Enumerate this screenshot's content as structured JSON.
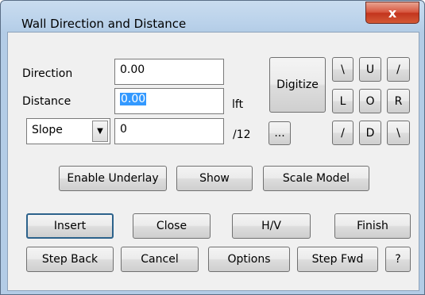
{
  "window": {
    "title": "Wall Direction and Distance",
    "close_glyph": "x"
  },
  "fields": {
    "direction_label": "Direction",
    "direction_value": "0.00",
    "distance_label": "Distance",
    "distance_value": "0.00",
    "distance_unit": "lft",
    "slope_option": "Slope",
    "slope_arrow": "▼",
    "slope_value": "0",
    "slope_unit": "/12"
  },
  "buttons": {
    "digitize": "Digitize",
    "ellipsis": "...",
    "dir_up_left": "\\",
    "dir_up": "U",
    "dir_up_right": "/",
    "dir_left": "L",
    "dir_origin": "O",
    "dir_right": "R",
    "dir_down_left": "/",
    "dir_down": "D",
    "dir_down_right": "\\",
    "enable_underlay": "Enable Underlay",
    "show": "Show",
    "scale_model": "Scale Model",
    "insert": "Insert",
    "close": "Close",
    "hv": "H/V",
    "finish": "Finish",
    "step_back": "Step Back",
    "cancel": "Cancel",
    "options": "Options",
    "step_fwd": "Step Fwd",
    "help": "?"
  }
}
